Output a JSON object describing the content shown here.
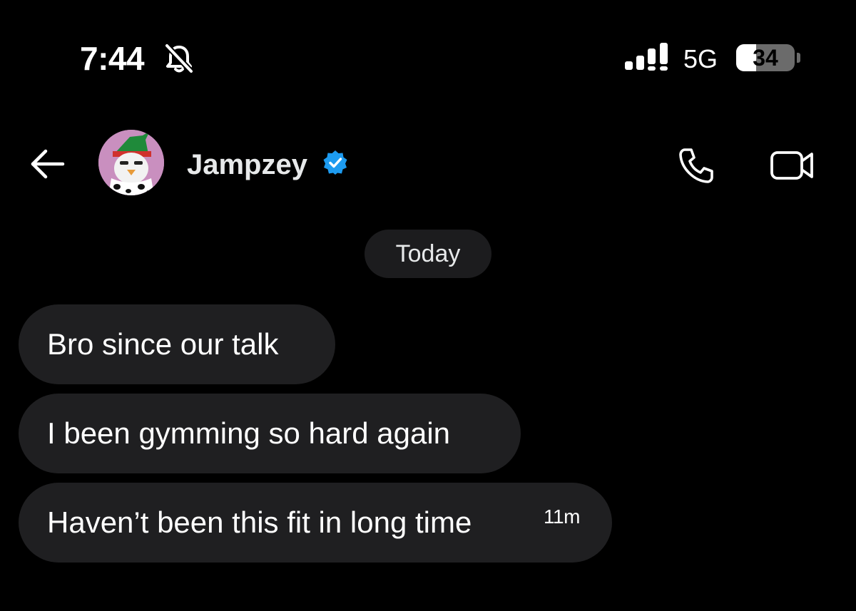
{
  "status_bar": {
    "time": "7:44",
    "network": "5G",
    "battery_percent": "34",
    "battery_level": 0.34
  },
  "header": {
    "contact_name": "Jampzey",
    "verified": true
  },
  "conversation": {
    "date_label": "Today",
    "messages": [
      {
        "text": "Bro since our talk"
      },
      {
        "text": "I been gymming so hard again"
      },
      {
        "text": "Haven’t been this fit in long time",
        "timestamp": "11m"
      }
    ]
  },
  "colors": {
    "background": "#000000",
    "bubble": "#1f1f21",
    "verified_blue": "#1d9bf0",
    "text": "#ffffff"
  }
}
